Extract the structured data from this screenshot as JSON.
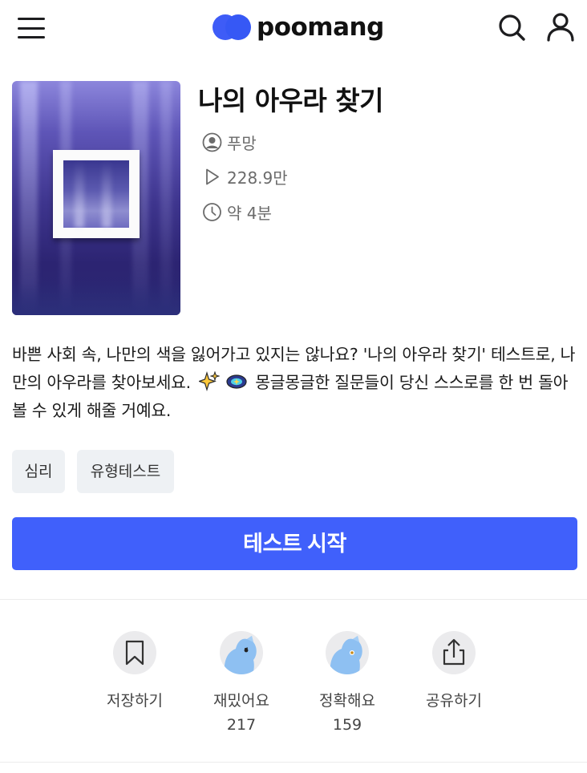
{
  "header": {
    "brand": "poomang",
    "brand_color": "#3e5cf7",
    "menu_icon": "hamburger-menu-icon",
    "search_icon": "search-icon",
    "profile_icon": "user-profile-icon"
  },
  "test": {
    "title": "나의 아우라 찾기",
    "author": "푸망",
    "plays": "228.9만",
    "duration": "약 4분",
    "description_1": "바쁜 사회 속, 나만의 색을 잃어가고 있지는 않나요? '나의 아우라 찾기' 테스트로, 나만의 아우라를 찾아보세요. ",
    "description_2": " 몽글몽글한 질문들이 당신 스스로를 한 번 돌아볼 수 있게 해줄 거예요.",
    "tags": [
      "심리",
      "유형테스트"
    ],
    "start_label": "테스트 시작",
    "accent_color": "#4060fb"
  },
  "actions": {
    "save": {
      "label": "저장하기",
      "icon": "bookmark-icon"
    },
    "fun": {
      "label": "재밌어요",
      "count": "217",
      "icon": "mascot-fun-icon"
    },
    "accurate": {
      "label": "정확해요",
      "count": "159",
      "icon": "mascot-accurate-icon"
    },
    "share": {
      "label": "공유하기",
      "icon": "share-icon"
    }
  }
}
